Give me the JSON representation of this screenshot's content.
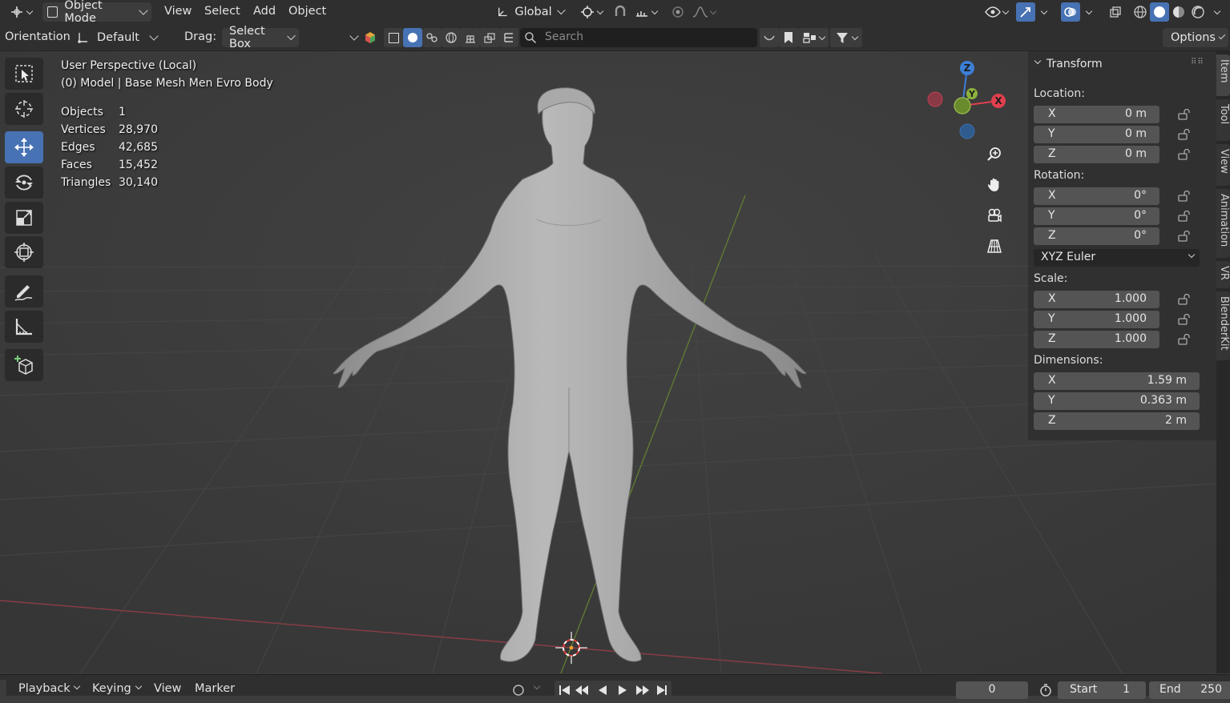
{
  "header": {
    "mode": "Object Mode",
    "menus": [
      "View",
      "Select",
      "Add",
      "Object"
    ],
    "transform_orientation": "Global"
  },
  "tool_settings": {
    "orientation_label": "Orientation:",
    "orientation_value": "Default",
    "drag_label": "Drag:",
    "drag_value": "Select Box",
    "search_placeholder": "Search",
    "options_label": "Options"
  },
  "viewport": {
    "perspective": "User Perspective (Local)",
    "object_info": "(0) Model | Base Mesh Men Evro Body",
    "stats": [
      {
        "label": "Objects",
        "value": "1"
      },
      {
        "label": "Vertices",
        "value": "28,970"
      },
      {
        "label": "Edges",
        "value": "42,685"
      },
      {
        "label": "Faces",
        "value": "15,452"
      },
      {
        "label": "Triangles",
        "value": "30,140"
      }
    ],
    "gizmo_axes": {
      "x": "X",
      "y": "Y",
      "z": "Z"
    }
  },
  "transform_panel": {
    "title": "Transform",
    "location_label": "Location:",
    "location": [
      {
        "axis": "X",
        "value": "0 m"
      },
      {
        "axis": "Y",
        "value": "0 m"
      },
      {
        "axis": "Z",
        "value": "0 m"
      }
    ],
    "rotation_label": "Rotation:",
    "rotation": [
      {
        "axis": "X",
        "value": "0°"
      },
      {
        "axis": "Y",
        "value": "0°"
      },
      {
        "axis": "Z",
        "value": "0°"
      }
    ],
    "rotation_mode": "XYZ Euler",
    "scale_label": "Scale:",
    "scale": [
      {
        "axis": "X",
        "value": "1.000"
      },
      {
        "axis": "Y",
        "value": "1.000"
      },
      {
        "axis": "Z",
        "value": "1.000"
      }
    ],
    "dimensions_label": "Dimensions:",
    "dimensions": [
      {
        "axis": "X",
        "value": "1.59 m"
      },
      {
        "axis": "Y",
        "value": "0.363 m"
      },
      {
        "axis": "Z",
        "value": "2 m"
      }
    ]
  },
  "side_tabs": [
    "Item",
    "Tool",
    "View",
    "Animation",
    "VR",
    "BlenderKit"
  ],
  "timeline": {
    "menus": [
      "Playback",
      "Keying",
      "View",
      "Marker"
    ],
    "current_frame": "0",
    "start_label": "Start",
    "start_value": "1",
    "end_label": "End",
    "end_value": "250"
  },
  "colors": {
    "accent": "#4772b3",
    "axis_x": "#e0404f",
    "axis_y": "#8cb33c",
    "axis_z": "#3c7fd6"
  }
}
